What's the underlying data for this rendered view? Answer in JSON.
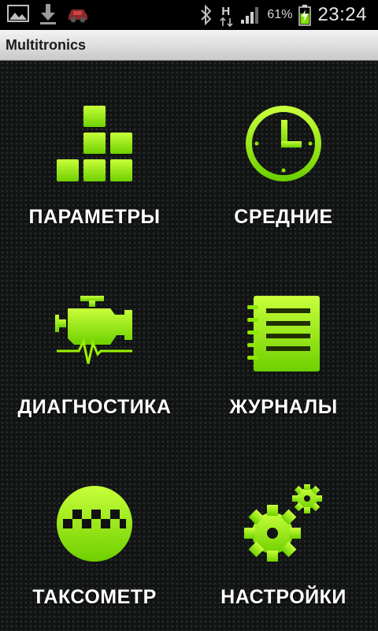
{
  "status_bar": {
    "icons_left": [
      "image-icon",
      "download-icon",
      "car-icon"
    ],
    "network_type": "H",
    "battery_percent": "61%",
    "time": "23:24"
  },
  "app": {
    "title": "Multitronics"
  },
  "colors": {
    "accent_green": "#7fe000",
    "accent_green_light": "#b6ff2a",
    "background": "#121414",
    "label_white": "#ffffff"
  },
  "menu": {
    "items": [
      {
        "label": "ПАРАМЕТРЫ",
        "icon": "bars-icon"
      },
      {
        "label": "СРЕДНИЕ",
        "icon": "clock-icon"
      },
      {
        "label": "ДИАГНОСТИКА",
        "icon": "engine-icon"
      },
      {
        "label": "ЖУРНАЛЫ",
        "icon": "notebook-icon"
      },
      {
        "label": "ТАКСОМЕТР",
        "icon": "taxi-icon"
      },
      {
        "label": "НАСТРОЙКИ",
        "icon": "gears-icon"
      }
    ]
  }
}
